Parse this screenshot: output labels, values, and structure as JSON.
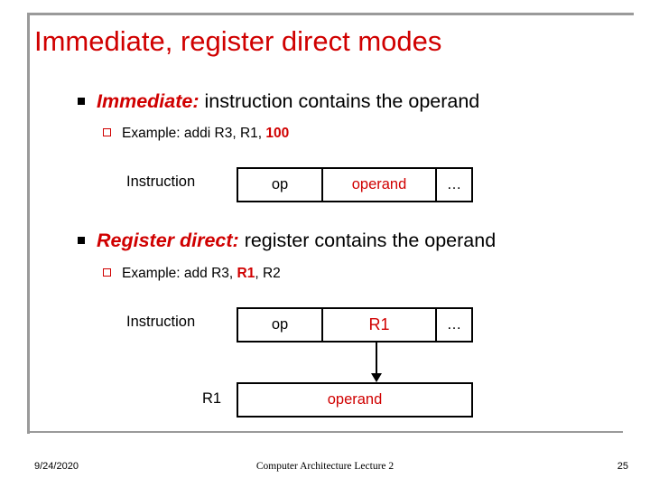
{
  "slide": {
    "title": "Immediate, register direct modes",
    "bullets": [
      {
        "emphasis": "Immediate:",
        "rest": " instruction contains the operand",
        "sub": {
          "prefix": "Example:  addi R3, R1, ",
          "highlight": "100"
        }
      },
      {
        "emphasis": "Register direct:",
        "rest": " register contains the operand",
        "sub": {
          "prefix": "Example:  add R3, ",
          "highlight": "R1",
          "suffix": ", R2"
        }
      }
    ],
    "diagram1": {
      "label": "Instruction",
      "cells": [
        {
          "text": "op",
          "style": "black"
        },
        {
          "text": "operand",
          "style": "red"
        },
        {
          "text": "…",
          "style": "black"
        }
      ]
    },
    "diagram2": {
      "label": "Instruction",
      "cells": [
        {
          "text": "op",
          "style": "black"
        },
        {
          "text": "R1",
          "style": "redbold"
        },
        {
          "text": "…",
          "style": "black"
        }
      ],
      "register_label": "R1",
      "register_value": "operand"
    }
  },
  "footer": {
    "date": "9/24/2020",
    "center": "Computer Architecture Lecture 2",
    "number": "25"
  }
}
